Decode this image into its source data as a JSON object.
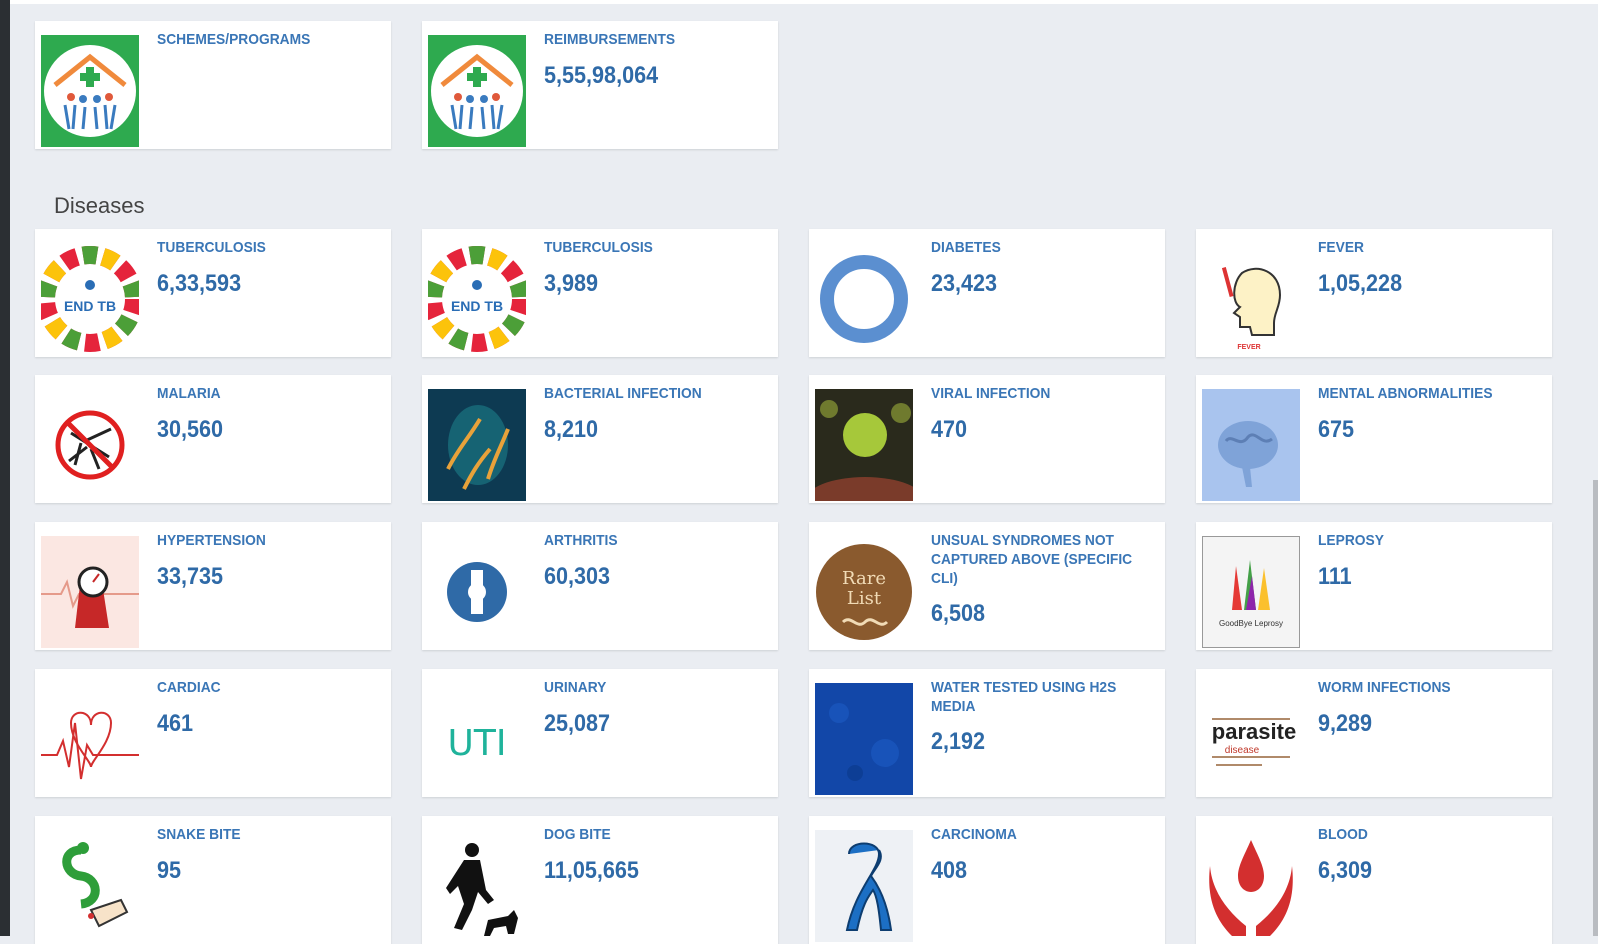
{
  "section": {
    "diseases_title": "Diseases"
  },
  "top_cards": [
    {
      "label": "SCHEMES/PROGRAMS",
      "value": "",
      "icon": "health-mission-logo-icon"
    },
    {
      "label": "REIMBURSEMENTS",
      "value": "5,55,98,064",
      "icon": "health-mission-logo-icon"
    }
  ],
  "cards": [
    {
      "label": "TUBERCULOSIS",
      "value": "6,33,593",
      "icon": "end-tb-icon"
    },
    {
      "label": "TUBERCULOSIS",
      "value": "3,989",
      "icon": "end-tb-icon"
    },
    {
      "label": "DIABETES",
      "value": "23,423",
      "icon": "blue-circle-icon"
    },
    {
      "label": "FEVER",
      "value": "1,05,228",
      "icon": "fever-icon"
    },
    {
      "label": "MALARIA",
      "value": "30,560",
      "icon": "no-mosquito-icon"
    },
    {
      "label": "BACTERIAL INFECTION",
      "value": "8,210",
      "icon": "bacteria-icon"
    },
    {
      "label": "VIRAL INFECTION",
      "value": "470",
      "icon": "virus-icon"
    },
    {
      "label": "MENTAL ABNORMALITIES",
      "value": "675",
      "icon": "brain-icon"
    },
    {
      "label": "HYPERTENSION",
      "value": "33,735",
      "icon": "blood-pressure-icon"
    },
    {
      "label": "ARTHRITIS",
      "value": "60,303",
      "icon": "knee-joint-icon"
    },
    {
      "label": "UNSUAL SYNDROMES NOT CAPTURED ABOVE (SPECIFIC CLI)",
      "value": "6,508",
      "icon": "rare-list-icon",
      "icon_text": [
        "Rare",
        "List"
      ]
    },
    {
      "label": "LEPROSY",
      "value": "111",
      "icon": "leprosy-hands-icon",
      "icon_text": [
        "GoodBye Leprosy"
      ]
    },
    {
      "label": "CARDIAC",
      "value": "461",
      "icon": "heart-pulse-icon"
    },
    {
      "label": "URINARY",
      "value": "25,087",
      "icon": "uti-text-icon",
      "icon_text": [
        "UTI"
      ]
    },
    {
      "label": "WATER TESTED USING H2S MEDIA",
      "value": "2,192",
      "icon": "water-texture-icon"
    },
    {
      "label": "WORM INFECTIONS",
      "value": "9,289",
      "icon": "parasite-word-cloud-icon",
      "icon_text": [
        "parasite",
        "disease"
      ]
    },
    {
      "label": "SNAKE BITE",
      "value": "95",
      "icon": "snake-bite-icon"
    },
    {
      "label": "DOG BITE",
      "value": "11,05,665",
      "icon": "dog-bite-icon"
    },
    {
      "label": "CARCINOMA",
      "value": "408",
      "icon": "cancer-ribbon-icon"
    },
    {
      "label": "BLOOD",
      "value": "6,309",
      "icon": "blood-drop-hands-icon"
    }
  ],
  "colors": {
    "label": "#3a76b6",
    "value": "#2f6aa7",
    "background": "#eaedf2"
  }
}
